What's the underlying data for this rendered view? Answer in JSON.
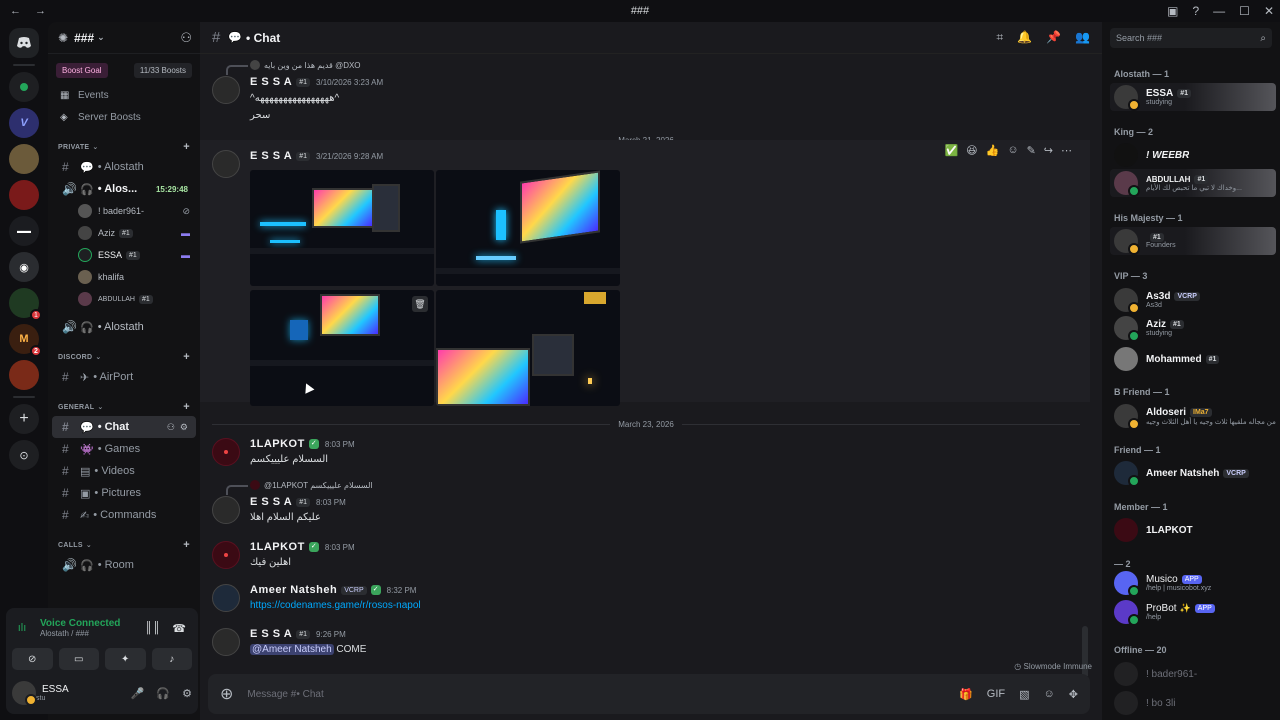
{
  "window": {
    "title": "###",
    "back": "←",
    "forward": "→",
    "icons": [
      "inbox-icon",
      "help-icon"
    ],
    "min": "—",
    "max": "☐",
    "close": "✕"
  },
  "sidebar": {
    "guild_name": "###",
    "boost_goal_label": "Boost Goal",
    "boost_count": "11/33 Boosts",
    "top_items": [
      {
        "icon": "calendar-icon",
        "label": "Events"
      },
      {
        "icon": "boost-icon",
        "label": "Server Boosts"
      }
    ],
    "categories": {
      "private": "PRIVATE",
      "discord": "DISCORD",
      "general": "GENERAL",
      "calls": "CALLS"
    },
    "private_channels": [
      {
        "name": "• Alostath",
        "type": "text"
      },
      {
        "name": "• Alos...",
        "type": "voice",
        "time": "15:29:48"
      }
    ],
    "voice_users": [
      {
        "name": "! bader961-",
        "badge": ""
      },
      {
        "name": "Aziz",
        "badge": "#1"
      },
      {
        "name": "ESSA",
        "badge": "#1"
      },
      {
        "name": "khalifa",
        "badge": ""
      },
      {
        "name": "ABDULLAH",
        "badge": "#1"
      }
    ],
    "voice_channel_2": "• Alostath",
    "discord_channels": [
      {
        "name": "• AirPort"
      }
    ],
    "general_channels": [
      {
        "name": "• Chat"
      },
      {
        "name": "• Games"
      },
      {
        "name": "• Videos"
      },
      {
        "name": "• Pictures"
      },
      {
        "name": "• Commands"
      }
    ],
    "calls_channels": [
      {
        "name": "• Room"
      }
    ]
  },
  "voice": {
    "title": "Voice Connected",
    "subtitle": "Alostath / ###"
  },
  "user": {
    "name": "ESSA",
    "status": "stu"
  },
  "chat": {
    "channel_title": "• Chat",
    "messages": [
      {
        "reply_text": "قديم هذا من وين بايه @DXO",
        "user": "E S S A",
        "badge": "#1",
        "time": "3/10/2026 3:23 AM",
        "lines": [
          "^ههههههههههههههههه^",
          "سحر"
        ]
      },
      {
        "user": "E S S A",
        "badge": "#1",
        "time": "3/21/2026 9:28 AM",
        "lines": []
      },
      {
        "user": "1LAPKOT",
        "time": "8:03 PM",
        "lines": [
          "السسلام عليييكسم"
        ]
      },
      {
        "reply_text": "@1LAPKOT السسلام عليييكسم",
        "user": "E S S A",
        "badge": "#1",
        "time": "8:03 PM",
        "lines": [
          "عليكم السلام اهلا"
        ]
      },
      {
        "user": "1LAPKOT",
        "time": "8:03 PM",
        "lines": [
          "اهلين فيك"
        ]
      },
      {
        "user": "Ameer Natsheh",
        "badge": "VCRP",
        "time": "8:32 PM",
        "link": "https://codenames.game/r/rosos-napol"
      },
      {
        "user": "E S S A",
        "badge": "#1",
        "time": "9:26 PM",
        "mention": "@Ameer Natsheh",
        "after_mention": "COME"
      }
    ],
    "dividers": [
      "March 21, 2026",
      "March 23, 2026"
    ],
    "slowmode": "Slowmode Immune",
    "composer_placeholder": "Message #• Chat"
  },
  "members": {
    "search_placeholder": "Search ###",
    "groups": [
      {
        "label": "Alostath — 1"
      },
      {
        "label": "King — 2"
      },
      {
        "label": "His Majesty — 1"
      },
      {
        "label": "VIP — 3"
      },
      {
        "label": "B Friend — 1"
      },
      {
        "label": "Friend — 1"
      },
      {
        "label": "Member — 1"
      },
      {
        "label": "— 2"
      },
      {
        "label": "Offline — 20"
      }
    ],
    "list": [
      {
        "name": "ESSA",
        "badge": "#1",
        "sub": "studying"
      },
      {
        "name": "! WEEBR",
        "badge": "",
        "sub": ""
      },
      {
        "name": "ABDULLAH",
        "badge": "#1",
        "sub": "وخداك لا تبي ما تحبص لك الأيام..."
      },
      {
        "name": "",
        "badge": "#1",
        "sub": "Founders"
      },
      {
        "name": "As3d",
        "badge": "VCRP",
        "sub": "As3d"
      },
      {
        "name": "Aziz",
        "badge": "#1",
        "sub": "studying"
      },
      {
        "name": "Mohammed",
        "badge": "#1",
        "sub": ""
      },
      {
        "name": "Aldoseri",
        "badge": "IMa7",
        "sub": "من مجاله ملقيها ثلاث وجيه يا أهل الثلاث وجيه ..."
      },
      {
        "name": "Ameer Natsheh",
        "badge": "VCRP",
        "sub": ""
      },
      {
        "name": "1LAPKOT",
        "badge": "",
        "sub": ""
      },
      {
        "name": "Musico",
        "badge": "APP",
        "sub": "/help | musicobot.xyz"
      },
      {
        "name": "ProBot",
        "badge": "APP",
        "sub": "/help"
      },
      {
        "name": "! bader961-",
        "badge": "",
        "sub": ""
      },
      {
        "name": "! bo 3li",
        "badge": "",
        "sub": ""
      }
    ]
  }
}
